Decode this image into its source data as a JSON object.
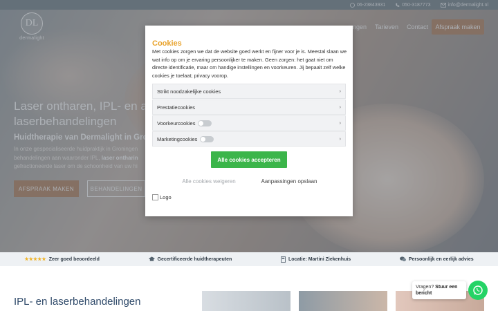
{
  "topbar": {
    "phone1": "06-23843931",
    "phone2": "050-3187773",
    "email": "info@dermalight.nl"
  },
  "logo": {
    "monogram": "DL",
    "word": "dermalight"
  },
  "nav": {
    "items": [
      "ngen",
      "Tarieven",
      "Contact"
    ],
    "cta": "Afspraak maken"
  },
  "hero": {
    "title": "Laser ontharen, IPL- en a laserbehandelingen",
    "subtitle": "Huidtherapie van Dermalight in Gron",
    "body_pre": "In onze gespecialiseerde huidpraktijk in Groningen behandelingen aan waaronder IPL, ",
    "body_link": "laser ontharin",
    "body_post": " gefractioneerde laser om de schoonheid van uw hi",
    "btn_primary": "AFSPRAAK MAKEN",
    "btn_secondary": "BEHANDELINGEN"
  },
  "features": [
    {
      "icon": "star-rating-icon",
      "label": "Zeer goed beoordeeld",
      "stars": "★★★★★"
    },
    {
      "icon": "certificate-icon",
      "label": "Gecertificeerde huidtherapeuten"
    },
    {
      "icon": "location-icon",
      "label": "Locatie: Martini Ziekenhuis"
    },
    {
      "icon": "chat-icon",
      "label": "Persoonlijk en eerlijk advies"
    }
  ],
  "section": {
    "title": "IPL- en laserbehandelingen"
  },
  "cookie_modal": {
    "title": "Cookies",
    "text": "Met cookies zorgen we dat de website goed werkt en fijner voor je is. Meestal slaan we wat info op om je ervaring persoonlijker te maken. Geen zorgen: het gaat niet om directe identificatie, maar om handige instellingen en voorkeuren. Jij bepaalt zelf welke cookies je toelaat; privacy voorop.",
    "categories": [
      {
        "label": "Strikt noodzakelijke cookies",
        "toggle": false
      },
      {
        "label": "Prestatiecookies",
        "toggle": false
      },
      {
        "label": "Voorkeurcookies",
        "toggle": true
      },
      {
        "label": "Marketingcookies",
        "toggle": true
      }
    ],
    "accept": "Alle cookies accepteren",
    "reject": "Alle cookies weigeren",
    "save": "Aanpassingen opslaan",
    "logo_alt": "Logo"
  },
  "chat": {
    "prefix": "Vragen?",
    "strong": "Stuur een bericht"
  },
  "colors": {
    "accent": "#b98b6a",
    "accept_green": "#3bb54a",
    "cookie_title": "#e8a22a",
    "whatsapp": "#25d366"
  }
}
